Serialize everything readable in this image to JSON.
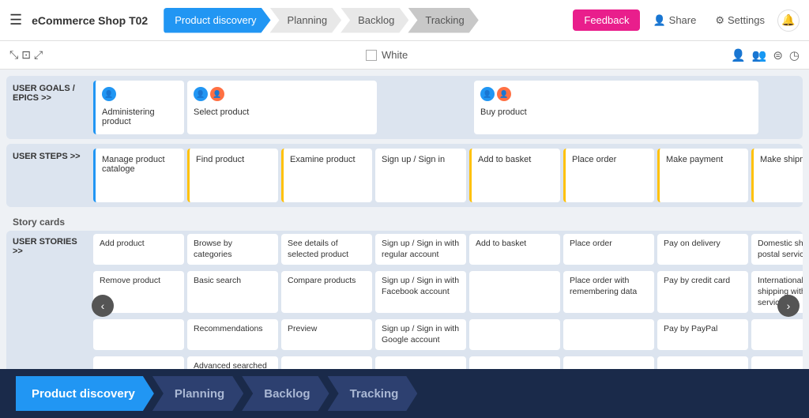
{
  "app": {
    "title": "eCommerce Shop T02",
    "menu_icon": "☰"
  },
  "nav": {
    "tabs": [
      {
        "id": "product-discovery",
        "label": "Product discovery",
        "state": "active"
      },
      {
        "id": "planning",
        "label": "Planning",
        "state": "inactive"
      },
      {
        "id": "backlog",
        "label": "Backlog",
        "state": "inactive"
      },
      {
        "id": "tracking",
        "label": "Tracking",
        "state": "inactive"
      }
    ]
  },
  "header_actions": {
    "feedback": "Feedback",
    "share": "Share",
    "settings": "Settings"
  },
  "toolbar": {
    "white_label": "White"
  },
  "grid": {
    "user_goals_label": "USER GOALS / EPICS >>",
    "user_steps_label": "USER STEPS >>",
    "story_cards_label": "Story cards",
    "user_stories_label": "USER STORIES >>",
    "epics": [
      {
        "id": "admin",
        "title": "Administering product",
        "avatar": "👤",
        "border": "blue"
      },
      {
        "id": "select",
        "title": "Select product",
        "avatars": [
          "blue",
          "orange"
        ],
        "border": "none"
      },
      {
        "id": "empty",
        "title": "",
        "border": "none"
      },
      {
        "id": "buy",
        "title": "Buy product",
        "avatars": [
          "blue",
          "orange"
        ],
        "border": "none"
      }
    ],
    "user_steps": [
      {
        "id": "manage",
        "label": "Manage product cataloge",
        "border": "blue"
      },
      {
        "id": "find",
        "label": "Find product",
        "border": "yellow"
      },
      {
        "id": "examine",
        "label": "Examine product",
        "border": "yellow"
      },
      {
        "id": "signup",
        "label": "Sign up / Sign in",
        "border": "none"
      },
      {
        "id": "basket",
        "label": "Add to basket",
        "border": "yellow"
      },
      {
        "id": "order",
        "label": "Place order",
        "border": "yellow"
      },
      {
        "id": "payment",
        "label": "Make payment",
        "border": "yellow"
      },
      {
        "id": "shipment",
        "label": "Make shipment",
        "border": "yellow"
      }
    ],
    "stories_col1": [
      {
        "text": "Add product"
      },
      {
        "text": "Remove product"
      },
      {
        "text": ""
      },
      {
        "text": ""
      }
    ],
    "stories_col2": [
      {
        "text": "Browse by categories"
      },
      {
        "text": "Basic search"
      },
      {
        "text": "Recommendations"
      },
      {
        "text": "Advanced searched"
      }
    ],
    "stories_col3": [
      {
        "text": "See details of selected product"
      },
      {
        "text": "Compare products"
      },
      {
        "text": "Preview"
      },
      {
        "text": ""
      }
    ],
    "stories_col4": [
      {
        "text": "Sign up / Sign in with regular account"
      },
      {
        "text": "Sign up / Sign in with Facebook account"
      },
      {
        "text": "Sign up / Sign in with Google account"
      },
      {
        "text": ""
      }
    ],
    "stories_col5": [
      {
        "text": "Add to basket"
      },
      {
        "text": ""
      },
      {
        "text": ""
      },
      {
        "text": ""
      }
    ],
    "stories_col6": [
      {
        "text": "Place order"
      },
      {
        "text": "Place order with remembering data"
      },
      {
        "text": ""
      },
      {
        "text": ""
      }
    ],
    "stories_col7": [
      {
        "text": "Pay on delivery"
      },
      {
        "text": "Pay by credit card"
      },
      {
        "text": "Pay by PayPal"
      },
      {
        "text": ""
      }
    ],
    "stories_col8": [
      {
        "text": "Domestic shipping postal service"
      },
      {
        "text": "International shipping with courier service"
      },
      {
        "text": ""
      },
      {
        "text": ""
      }
    ]
  },
  "bottom_nav": {
    "tabs": [
      {
        "id": "product-discovery",
        "label": "Product discovery",
        "state": "active"
      },
      {
        "id": "planning",
        "label": "Planning",
        "state": "inactive"
      },
      {
        "id": "backlog",
        "label": "Backlog",
        "state": "inactive"
      },
      {
        "id": "tracking",
        "label": "Tracking",
        "state": "inactive"
      }
    ]
  }
}
